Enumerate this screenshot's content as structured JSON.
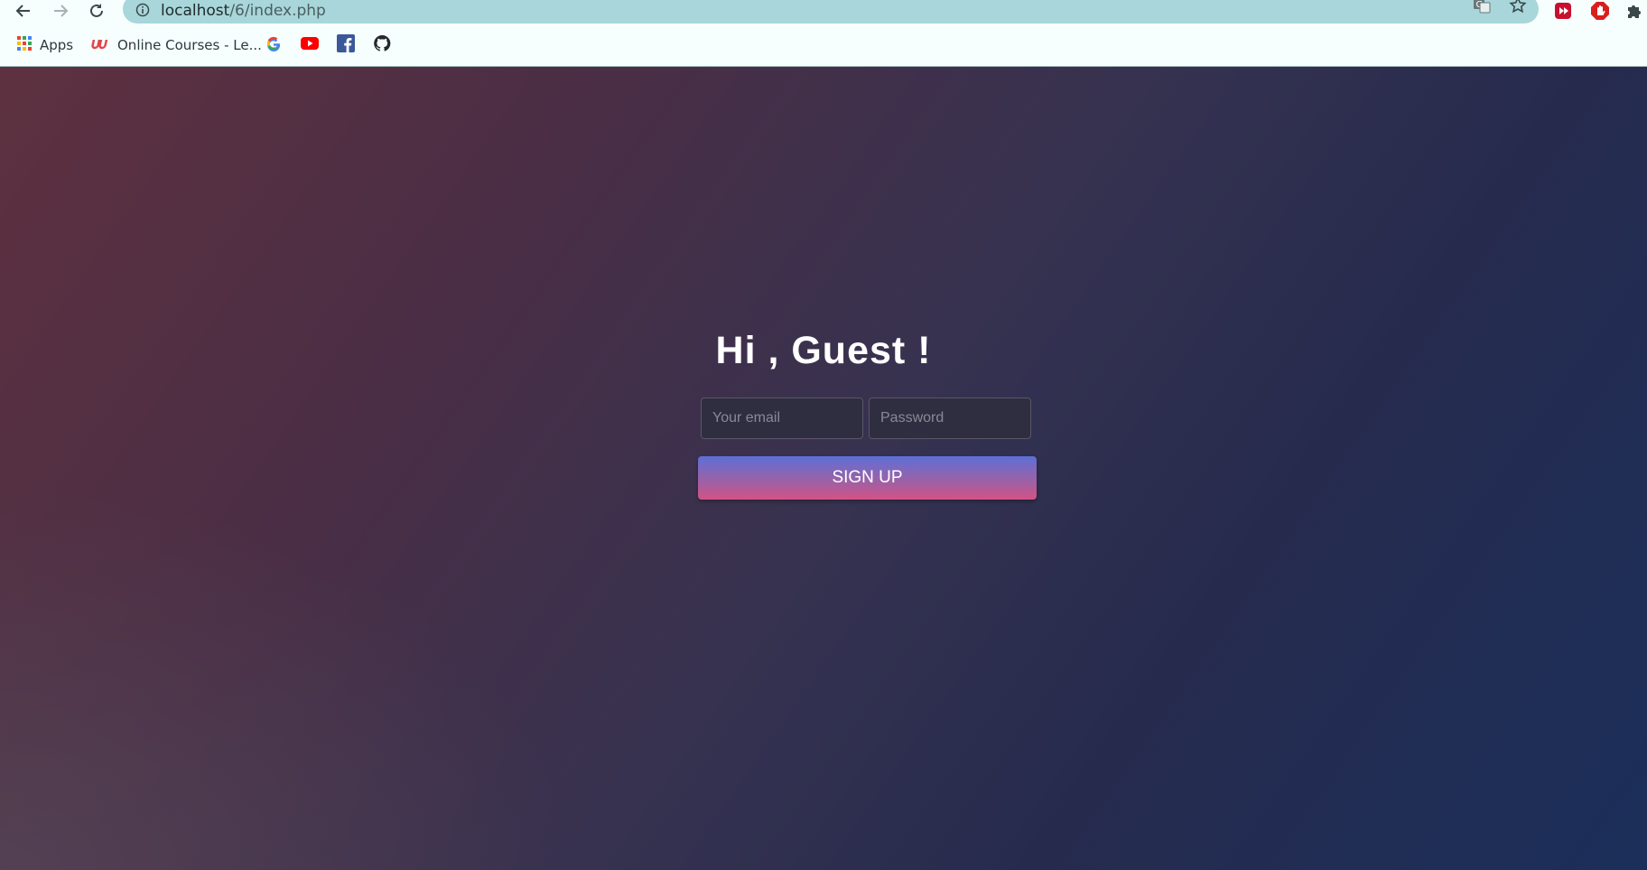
{
  "browser": {
    "url_host": "localhost",
    "url_path": "/6/index.php",
    "bookmarks": [
      {
        "label": "Apps",
        "icon": "apps-grid-icon"
      },
      {
        "label": "Online Courses - Le...",
        "icon": "udemy-icon"
      },
      {
        "label": "",
        "icon": "google-icon"
      },
      {
        "label": "",
        "icon": "youtube-icon"
      },
      {
        "label": "",
        "icon": "facebook-icon"
      },
      {
        "label": "",
        "icon": "github-icon"
      }
    ]
  },
  "page": {
    "heading": "Hi , Guest !",
    "email_placeholder": "Your email",
    "password_placeholder": "Password",
    "signup_label": "SIGN UP"
  },
  "colors": {
    "button_top": "#5d6fd6",
    "button_bottom": "#d45285",
    "background_start": "#5e3140",
    "background_end": "#1b2f5a"
  }
}
